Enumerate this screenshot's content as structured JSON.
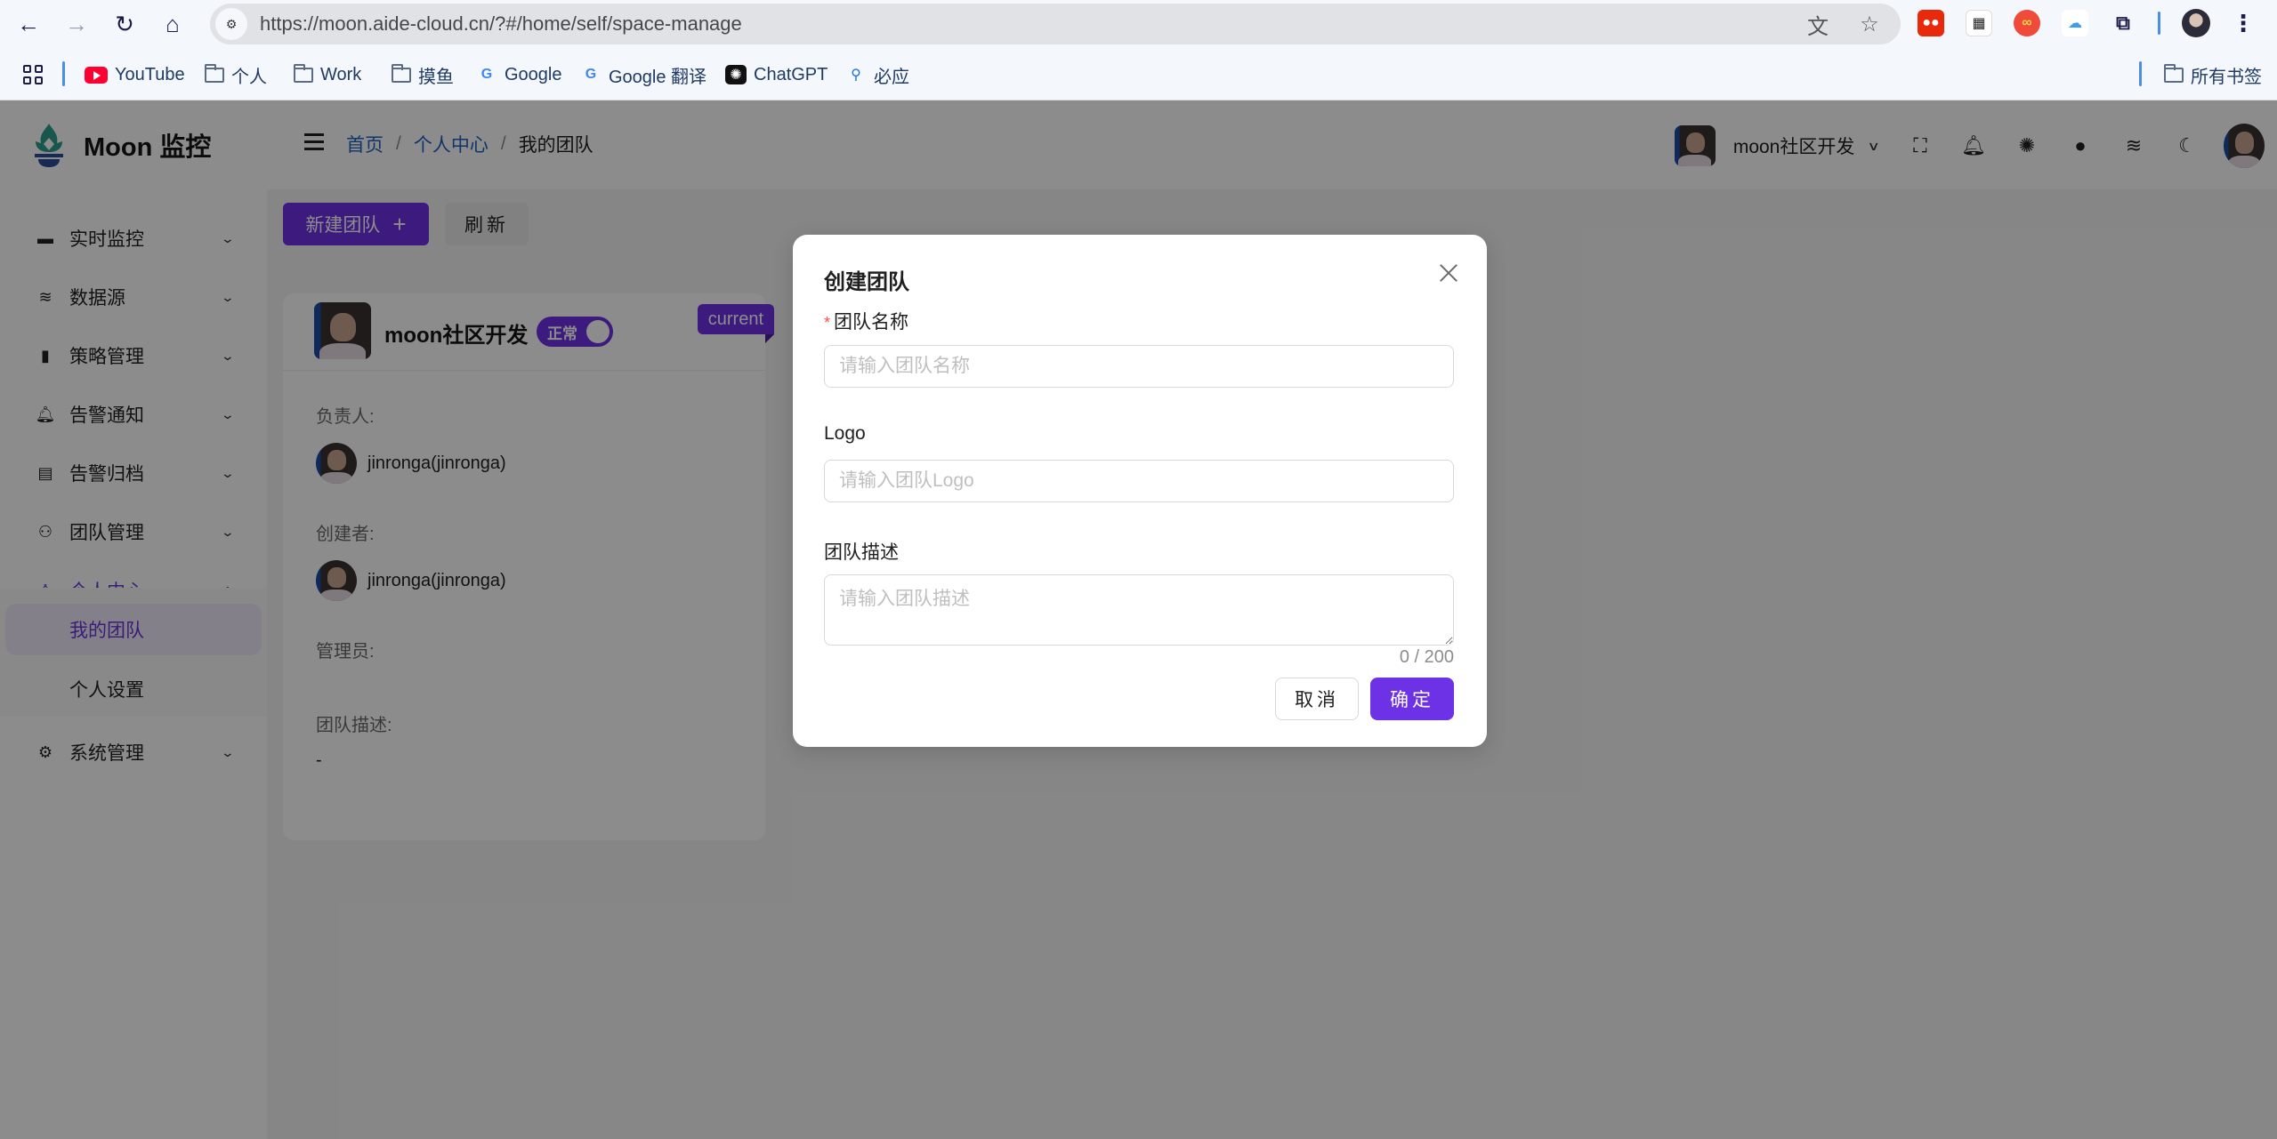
{
  "browser": {
    "url": "https://moon.aide-cloud.cn/?#/home/self/space-manage",
    "bookmarks": [
      {
        "label": "YouTube",
        "icon": "youtube-icon"
      },
      {
        "label": "个人",
        "icon": "folder-icon"
      },
      {
        "label": "Work",
        "icon": "folder-icon"
      },
      {
        "label": "摸鱼",
        "icon": "folder-icon"
      },
      {
        "label": "Google",
        "icon": "google-icon"
      },
      {
        "label": "Google 翻译",
        "icon": "google-translate-icon"
      },
      {
        "label": "ChatGPT",
        "icon": "chatgpt-icon"
      },
      {
        "label": "必应",
        "icon": "search-icon"
      }
    ],
    "all_bookmarks_label": "所有书签"
  },
  "app": {
    "logo_text": "Moon 监控",
    "sidebar": {
      "items": [
        {
          "label": "实时监控",
          "icon": "monitor-icon",
          "expanded": false
        },
        {
          "label": "数据源",
          "icon": "layers-icon",
          "expanded": false
        },
        {
          "label": "策略管理",
          "icon": "book-icon",
          "expanded": false
        },
        {
          "label": "告警通知",
          "icon": "bell-icon",
          "expanded": false
        },
        {
          "label": "告警归档",
          "icon": "archive-icon",
          "expanded": false
        },
        {
          "label": "团队管理",
          "icon": "team-icon",
          "expanded": false
        },
        {
          "label": "个人中心",
          "icon": "user-icon",
          "expanded": true,
          "children": [
            {
              "label": "我的团队",
              "active": true
            },
            {
              "label": "个人设置",
              "active": false
            }
          ]
        },
        {
          "label": "系统管理",
          "icon": "gear-icon",
          "expanded": false
        }
      ]
    },
    "header": {
      "breadcrumb": [
        "首页",
        "个人中心",
        "我的团队"
      ],
      "current_team": "moon社区开发"
    },
    "toolbar": {
      "new_team_label": "新建团队",
      "refresh_label": "刷新"
    },
    "team_card": {
      "name": "moon社区开发",
      "status_label": "正常",
      "status_on": true,
      "current_tag": "current",
      "owner_label": "负责人:",
      "owner_name": "jinronga(jinronga)",
      "creator_label": "创建者:",
      "creator_name": "jinronga(jinronga)",
      "admin_label": "管理员:",
      "desc_label": "团队描述:",
      "desc_value": "-"
    }
  },
  "modal": {
    "title": "创建团队",
    "fields": {
      "name": {
        "label": "团队名称",
        "required": true,
        "placeholder": "请输入团队名称",
        "value": ""
      },
      "logo": {
        "label": "Logo",
        "placeholder": "请输入团队Logo",
        "value": ""
      },
      "desc": {
        "label": "团队描述",
        "placeholder": "请输入团队描述",
        "value": "",
        "count": "0 / 200"
      }
    },
    "cancel_label": "取消",
    "ok_label": "确定"
  },
  "colors": {
    "primary": "#6d31e6",
    "link": "#1f5fbf",
    "required": "#ff4d4f"
  }
}
